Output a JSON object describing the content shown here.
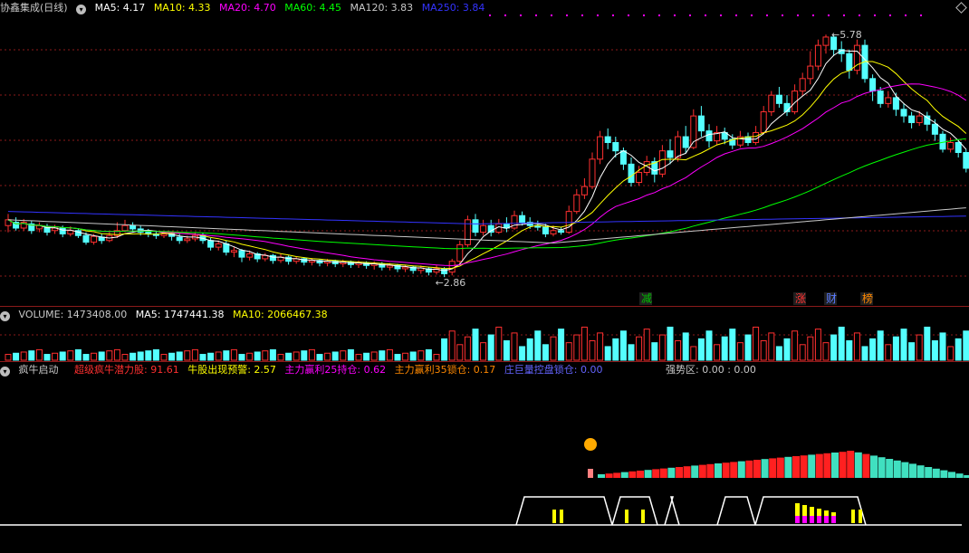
{
  "price_panel": {
    "stock_title": "协鑫集成(日线)",
    "ma_items": [
      {
        "label": "MA5: 4.17",
        "color": "#ffffff"
      },
      {
        "label": "MA10: 4.33",
        "color": "#ffff00"
      },
      {
        "label": "MA20: 4.70",
        "color": "#ff00ff"
      },
      {
        "label": "MA60: 4.45",
        "color": "#00ff00"
      },
      {
        "label": "MA120: 3.83",
        "color": "#c8c8c8"
      },
      {
        "label": "MA250: 3.84",
        "color": "#3333ff"
      }
    ],
    "high_label": "5.78",
    "low_label": "2.86",
    "event_labels": [
      {
        "text": "减",
        "color": "#00c000"
      },
      {
        "text": "涨",
        "color": "#ff3030"
      },
      {
        "text": "财",
        "color": "#5a7cff"
      },
      {
        "text": "榜",
        "color": "#ff8800"
      }
    ]
  },
  "volume_panel": {
    "header": {
      "label": "VOLUME: 1473408.00",
      "color": "#c8c8c8"
    },
    "ma_items": [
      {
        "label": "MA5: 1747441.38",
        "color": "#ffffff"
      },
      {
        "label": "MA10: 2066467.38",
        "color": "#ffff00"
      }
    ]
  },
  "indicator_panel": {
    "title": "疯牛启动",
    "items": [
      {
        "label": "超级疯牛潜力股: 91.61",
        "color": "#ff3030"
      },
      {
        "label": "牛股出现预警: 2.57",
        "color": "#ffff00"
      },
      {
        "label": "主力赢利25持仓: 0.62",
        "color": "#ff00ff"
      },
      {
        "label": "主力赢利35锁仓: 0.17",
        "color": "#ff8800"
      },
      {
        "label": "庄巨量控盘锁仓: 0.00",
        "color": "#6464ff"
      },
      {
        "label": "强势区: 0.00 : 0.00",
        "color": "#c8c8c8"
      }
    ]
  },
  "colors": {
    "up": "#ff3030",
    "down": "#54ffff",
    "grid": "#8b1a1a",
    "bg": "#000000"
  },
  "chart_data": {
    "type": "candlestick",
    "price_range": [
      2.6,
      6.0
    ],
    "candles": [
      [
        3.48,
        3.55,
        3.62,
        3.4
      ],
      [
        3.52,
        3.45,
        3.58,
        3.42
      ],
      [
        3.45,
        3.52,
        3.56,
        3.42
      ],
      [
        3.5,
        3.42,
        3.54,
        3.38
      ],
      [
        3.44,
        3.48,
        3.52,
        3.4
      ],
      [
        3.47,
        3.4,
        3.5,
        3.36
      ],
      [
        3.42,
        3.45,
        3.49,
        3.38
      ],
      [
        3.45,
        3.38,
        3.48,
        3.34
      ],
      [
        3.38,
        3.42,
        3.47,
        3.35
      ],
      [
        3.42,
        3.36,
        3.45,
        3.33
      ],
      [
        3.36,
        3.28,
        3.4,
        3.25
      ],
      [
        3.28,
        3.35,
        3.38,
        3.25
      ],
      [
        3.34,
        3.3,
        3.38,
        3.26
      ],
      [
        3.3,
        3.36,
        3.4,
        3.28
      ],
      [
        3.36,
        3.42,
        3.52,
        3.33
      ],
      [
        3.42,
        3.48,
        3.55,
        3.4
      ],
      [
        3.48,
        3.44,
        3.52,
        3.4
      ],
      [
        3.44,
        3.4,
        3.48,
        3.36
      ],
      [
        3.4,
        3.38,
        3.44,
        3.34
      ],
      [
        3.38,
        3.36,
        3.42,
        3.32
      ],
      [
        3.36,
        3.38,
        3.41,
        3.33
      ],
      [
        3.38,
        3.35,
        3.4,
        3.3
      ],
      [
        3.34,
        3.3,
        3.38,
        3.26
      ],
      [
        3.3,
        3.32,
        3.36,
        3.27
      ],
      [
        3.32,
        3.36,
        3.4,
        3.29
      ],
      [
        3.36,
        3.3,
        3.39,
        3.26
      ],
      [
        3.3,
        3.22,
        3.33,
        3.18
      ],
      [
        3.22,
        3.26,
        3.3,
        3.18
      ],
      [
        3.26,
        3.16,
        3.3,
        3.12
      ],
      [
        3.16,
        3.18,
        3.22,
        3.1
      ],
      [
        3.18,
        3.1,
        3.2,
        3.04
      ],
      [
        3.1,
        3.14,
        3.18,
        3.06
      ],
      [
        3.14,
        3.08,
        3.16,
        3.04
      ],
      [
        3.08,
        3.12,
        3.15,
        3.05
      ],
      [
        3.12,
        3.06,
        3.14,
        3.02
      ],
      [
        3.06,
        3.1,
        3.14,
        3.03
      ],
      [
        3.1,
        3.05,
        3.12,
        3.01
      ],
      [
        3.05,
        3.08,
        3.11,
        3.02
      ],
      [
        3.08,
        3.04,
        3.1,
        3.0
      ],
      [
        3.04,
        3.06,
        3.09,
        3.0
      ],
      [
        3.06,
        3.03,
        3.08,
        2.99
      ],
      [
        3.03,
        3.05,
        3.08,
        2.99
      ],
      [
        3.05,
        3.02,
        3.07,
        2.98
      ],
      [
        3.02,
        3.04,
        3.07,
        2.98
      ],
      [
        3.04,
        3.01,
        3.06,
        2.97
      ],
      [
        3.01,
        3.03,
        3.06,
        2.97
      ],
      [
        3.03,
        3.0,
        3.05,
        2.96
      ],
      [
        3.0,
        3.02,
        3.05,
        2.95
      ],
      [
        3.02,
        2.98,
        3.04,
        2.94
      ],
      [
        2.98,
        3.0,
        3.03,
        2.94
      ],
      [
        3.0,
        2.96,
        3.02,
        2.92
      ],
      [
        2.96,
        2.98,
        3.01,
        2.92
      ],
      [
        2.98,
        2.94,
        3.0,
        2.9
      ],
      [
        2.94,
        2.97,
        3.0,
        2.9
      ],
      [
        2.96,
        2.92,
        2.98,
        2.88
      ],
      [
        2.92,
        2.96,
        3.0,
        2.89
      ],
      [
        2.96,
        2.9,
        2.98,
        2.86
      ],
      [
        2.92,
        3.05,
        3.08,
        2.88
      ],
      [
        3.05,
        3.25,
        3.3,
        3.02
      ],
      [
        3.25,
        3.55,
        3.6,
        3.22
      ],
      [
        3.55,
        3.4,
        3.62,
        3.35
      ],
      [
        3.4,
        3.48,
        3.55,
        3.36
      ],
      [
        3.48,
        3.4,
        3.55,
        3.35
      ],
      [
        3.4,
        3.5,
        3.56,
        3.38
      ],
      [
        3.5,
        3.45,
        3.58,
        3.4
      ],
      [
        3.45,
        3.6,
        3.66,
        3.43
      ],
      [
        3.6,
        3.52,
        3.65,
        3.48
      ],
      [
        3.52,
        3.48,
        3.58,
        3.44
      ],
      [
        3.48,
        3.46,
        3.54,
        3.42
      ],
      [
        3.46,
        3.38,
        3.5,
        3.34
      ],
      [
        3.38,
        3.42,
        3.48,
        3.35
      ],
      [
        3.42,
        3.4,
        3.46,
        3.37
      ],
      [
        3.4,
        3.65,
        3.72,
        3.38
      ],
      [
        3.65,
        3.85,
        3.92,
        3.62
      ],
      [
        3.85,
        3.95,
        4.05,
        3.8
      ],
      [
        3.95,
        4.28,
        4.36,
        3.92
      ],
      [
        4.28,
        4.55,
        4.62,
        4.22
      ],
      [
        4.55,
        4.48,
        4.65,
        4.4
      ],
      [
        4.48,
        4.38,
        4.55,
        4.3
      ],
      [
        4.38,
        4.22,
        4.42,
        4.15
      ],
      [
        4.22,
        4.0,
        4.3,
        3.95
      ],
      [
        4.0,
        4.12,
        4.2,
        3.96
      ],
      [
        4.12,
        4.25,
        4.32,
        4.08
      ],
      [
        4.25,
        4.1,
        4.3,
        4.0
      ],
      [
        4.1,
        4.38,
        4.45,
        4.06
      ],
      [
        4.38,
        4.3,
        4.52,
        4.22
      ],
      [
        4.3,
        4.55,
        4.62,
        4.25
      ],
      [
        4.55,
        4.42,
        4.68,
        4.35
      ],
      [
        4.42,
        4.8,
        4.88,
        4.4
      ],
      [
        4.8,
        4.62,
        4.92,
        4.55
      ],
      [
        4.62,
        4.5,
        4.7,
        4.42
      ],
      [
        4.5,
        4.6,
        4.68,
        4.45
      ],
      [
        4.6,
        4.52,
        4.66,
        4.46
      ],
      [
        4.52,
        4.45,
        4.58,
        4.4
      ],
      [
        4.45,
        4.55,
        4.62,
        4.42
      ],
      [
        4.55,
        4.48,
        4.6,
        4.44
      ],
      [
        4.48,
        4.6,
        4.68,
        4.45
      ],
      [
        4.6,
        4.85,
        4.92,
        4.58
      ],
      [
        4.85,
        5.05,
        5.1,
        4.8
      ],
      [
        5.05,
        4.95,
        5.15,
        4.9
      ],
      [
        4.95,
        4.85,
        5.05,
        4.8
      ],
      [
        4.85,
        5.1,
        5.18,
        4.82
      ],
      [
        5.1,
        5.25,
        5.32,
        5.05
      ],
      [
        5.25,
        5.4,
        5.58,
        5.18
      ],
      [
        5.4,
        5.65,
        5.72,
        5.35
      ],
      [
        5.65,
        5.75,
        5.78,
        5.55
      ],
      [
        5.75,
        5.6,
        5.78,
        5.52
      ],
      [
        5.6,
        5.55,
        5.7,
        5.45
      ],
      [
        5.55,
        5.35,
        5.6,
        5.25
      ],
      [
        5.35,
        5.65,
        5.72,
        5.3
      ],
      [
        5.65,
        5.25,
        5.72,
        5.2
      ],
      [
        5.25,
        5.1,
        5.3,
        4.98
      ],
      [
        5.1,
        4.95,
        5.15,
        4.9
      ],
      [
        4.95,
        5.02,
        5.1,
        4.9
      ],
      [
        5.02,
        4.88,
        5.08,
        4.8
      ],
      [
        4.88,
        4.8,
        4.95,
        4.72
      ],
      [
        4.8,
        4.72,
        4.85,
        4.65
      ],
      [
        4.72,
        4.8,
        4.86,
        4.68
      ],
      [
        4.8,
        4.7,
        4.85,
        4.62
      ],
      [
        4.7,
        4.58,
        4.76,
        4.5
      ],
      [
        4.58,
        4.4,
        4.62,
        4.36
      ],
      [
        4.4,
        4.48,
        4.54,
        4.36
      ],
      [
        4.48,
        4.36,
        4.52,
        4.3
      ],
      [
        4.36,
        4.17,
        4.4,
        4.12
      ]
    ]
  }
}
